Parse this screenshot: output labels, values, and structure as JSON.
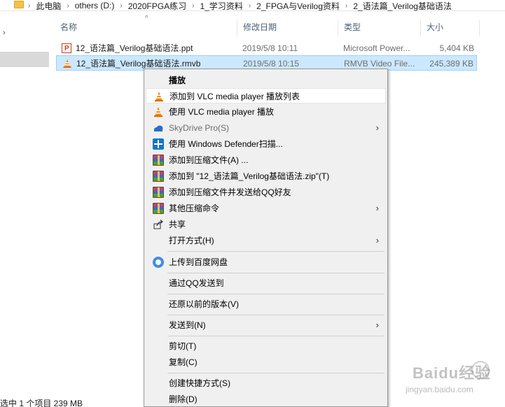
{
  "breadcrumb": [
    "此电脑",
    "others (D:)",
    "2020FPGA练习",
    "1_学习资料",
    "2_FPGA与Verilog资料",
    "2_语法篇_Verilog基础语法"
  ],
  "columns": {
    "name": "名称",
    "date": "修改日期",
    "type": "类型",
    "size": "大小"
  },
  "files": [
    {
      "name": "12_语法篇_Verilog基础语法.ppt",
      "date": "2019/5/8 10:11",
      "type": "Microsoft Power...",
      "size": "5,404 KB",
      "icon": "ppt-file-icon"
    },
    {
      "name": "12_语法篇_Verilog基础语法.rmvb",
      "date": "2019/5/8 10:15",
      "type": "RMVB Video File...",
      "size": "245,389 KB",
      "icon": "vlc-file-icon"
    }
  ],
  "status_bar": "选中 1 个项目  239 MB",
  "context_menu": {
    "items": [
      {
        "label": "播放",
        "icon": "none"
      },
      {
        "label": "添加到 VLC media player 播放列表",
        "icon": "vlc-icon"
      },
      {
        "label": "使用 VLC media player 播放",
        "icon": "vlc-icon"
      },
      {
        "label": "SkyDrive Pro(S)",
        "icon": "skydrive-icon"
      },
      {
        "label": "使用 Windows Defender扫描...",
        "icon": "windows-defender-icon"
      },
      {
        "label": "添加到压缩文件(A) ...",
        "icon": "winrar-icon"
      },
      {
        "label": "添加到 \"12_语法篇_Verilog基础语法.zip\"(T)",
        "icon": "winrar-icon"
      },
      {
        "label": "添加到压缩文件并发送给QQ好友",
        "icon": "winrar-icon"
      },
      {
        "label": "其他压缩命令",
        "icon": "winrar-icon"
      },
      {
        "label": "共享",
        "icon": "share-icon"
      },
      {
        "label": "打开方式(H)",
        "icon": "none"
      },
      {
        "label": "上传到百度网盘",
        "icon": "baidu-netdisk-icon"
      },
      {
        "label": "通过QQ发送到",
        "icon": "none"
      },
      {
        "label": "还原以前的版本(V)",
        "icon": "none"
      },
      {
        "label": "发送到(N)",
        "icon": "none"
      },
      {
        "label": "剪切(T)",
        "icon": "none"
      },
      {
        "label": "复制(C)",
        "icon": "none"
      },
      {
        "label": "创建快捷方式(S)",
        "icon": "none"
      },
      {
        "label": "删除(D)",
        "icon": "none"
      }
    ]
  },
  "watermark": {
    "text": "Baidu经验",
    "url": "jingyan.baidu.com"
  },
  "colors": {
    "selection_bg": "#cce8ff",
    "selection_border": "#99d1ff",
    "menu_bg": "#f0f0f0",
    "header_text": "#4c607a"
  }
}
